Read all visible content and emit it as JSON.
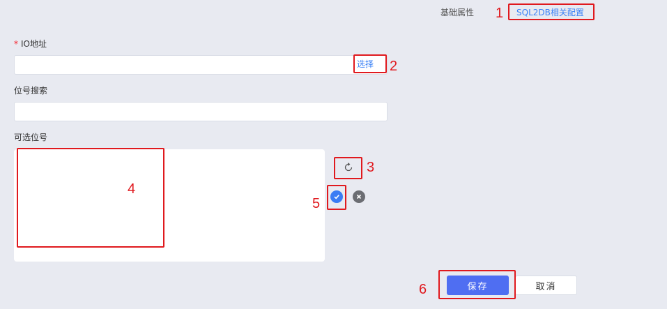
{
  "tabs": {
    "basic": "基础属性",
    "sql2db": "SQL2DB相关配置"
  },
  "form": {
    "io_label": "IO地址",
    "io_required_mark": "*",
    "io_value": "",
    "select_label": "选择",
    "position_search_label": "位号搜索",
    "position_search_value": "",
    "available_label": "可选位号"
  },
  "actions": {
    "save": "保存",
    "cancel": "取消"
  },
  "annotations": [
    "1",
    "2",
    "3",
    "4",
    "5",
    "6"
  ],
  "colors": {
    "accent": "#3b82f6",
    "primary_button": "#4f6ef2",
    "annotation_red": "#e0191e",
    "background": "#e8eaf1"
  },
  "icons": {
    "refresh": "refresh-icon",
    "confirm": "check-circle-icon",
    "cancel": "close-circle-icon"
  }
}
